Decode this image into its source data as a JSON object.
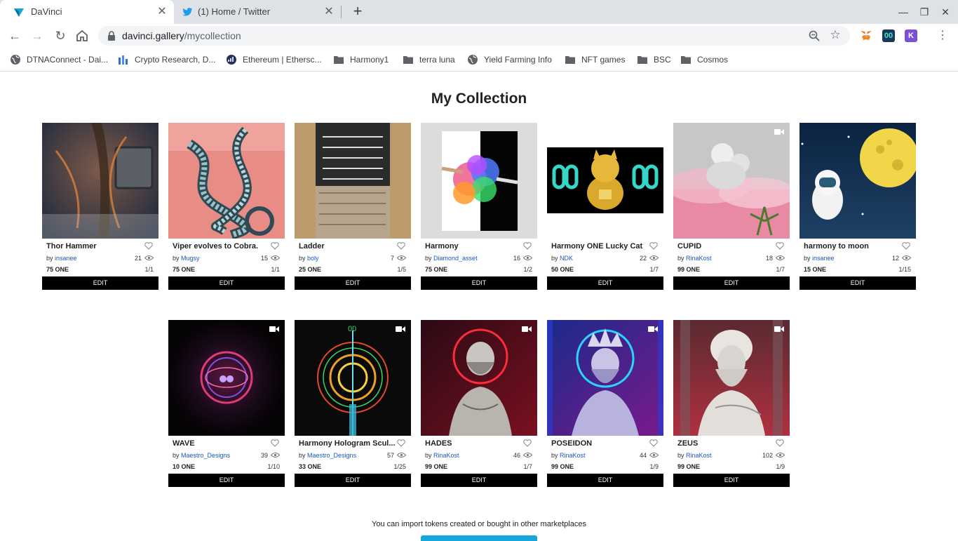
{
  "browser": {
    "tabs": [
      {
        "title": "DaVinci",
        "active": true,
        "icon": "davinci-icon"
      },
      {
        "title": "(1) Home / Twitter",
        "active": false,
        "icon": "twitter-icon"
      }
    ],
    "url_host": "davinci.gallery",
    "url_path": "/mycollection",
    "bookmarks": [
      {
        "label": "DTNAConnect - Dai...",
        "icon": "globe-icon"
      },
      {
        "label": "Crypto Research, D...",
        "icon": "chart-icon"
      },
      {
        "label": "Ethereum | Ethersc...",
        "icon": "etherscan-icon"
      },
      {
        "label": "Harmony1",
        "icon": "folder-icon"
      },
      {
        "label": "terra luna",
        "icon": "folder-icon"
      },
      {
        "label": "Yield Farming Info",
        "icon": "globe-icon"
      },
      {
        "label": "NFT games",
        "icon": "folder-icon"
      },
      {
        "label": "BSC",
        "icon": "folder-icon"
      },
      {
        "label": "Cosmos",
        "icon": "folder-icon"
      }
    ]
  },
  "page": {
    "title": "My Collection",
    "by_prefix": "by",
    "edit_label": "EDIT",
    "import_note": "You can import tokens created or bought in other marketplaces"
  },
  "cards": [
    {
      "name": "Thor Hammer",
      "author": "insanee",
      "views": "21",
      "price": "75 ONE",
      "edition": "1/1",
      "video": false
    },
    {
      "name": "Viper evolves to Cobra.",
      "author": "Mugsy",
      "views": "15",
      "price": "75 ONE",
      "edition": "1/1",
      "video": false
    },
    {
      "name": "Ladder",
      "author": "boly",
      "views": "7",
      "price": "25 ONE",
      "edition": "1/5",
      "video": false
    },
    {
      "name": "Harmony",
      "author": "Diamond_asset",
      "views": "16",
      "price": "75 ONE",
      "edition": "1/2",
      "video": false
    },
    {
      "name": "Harmony ONE Lucky Cat",
      "author": "NDK",
      "views": "22",
      "price": "50 ONE",
      "edition": "1/7",
      "video": false
    },
    {
      "name": "CUPID",
      "author": "RinaKost",
      "views": "18",
      "price": "99 ONE",
      "edition": "1/7",
      "video": true
    },
    {
      "name": "harmony to moon",
      "author": "insanee",
      "views": "12",
      "price": "15 ONE",
      "edition": "1/15",
      "video": false
    },
    {
      "name": "WAVE",
      "author": "Maestro_Designs",
      "views": "39",
      "price": "10 ONE",
      "edition": "1/10",
      "video": true
    },
    {
      "name": "Harmony Hologram Scul...",
      "author": "Maestro_Designs",
      "views": "57",
      "price": "33 ONE",
      "edition": "1/25",
      "video": true
    },
    {
      "name": "HADES",
      "author": "RinaKost",
      "views": "46",
      "price": "99 ONE",
      "edition": "1/7",
      "video": true
    },
    {
      "name": "POSEIDON",
      "author": "RinaKost",
      "views": "44",
      "price": "99 ONE",
      "edition": "1/9",
      "video": true
    },
    {
      "name": "ZEUS",
      "author": "RinaKost",
      "views": "102",
      "price": "99 ONE",
      "edition": "1/9",
      "video": true
    }
  ]
}
